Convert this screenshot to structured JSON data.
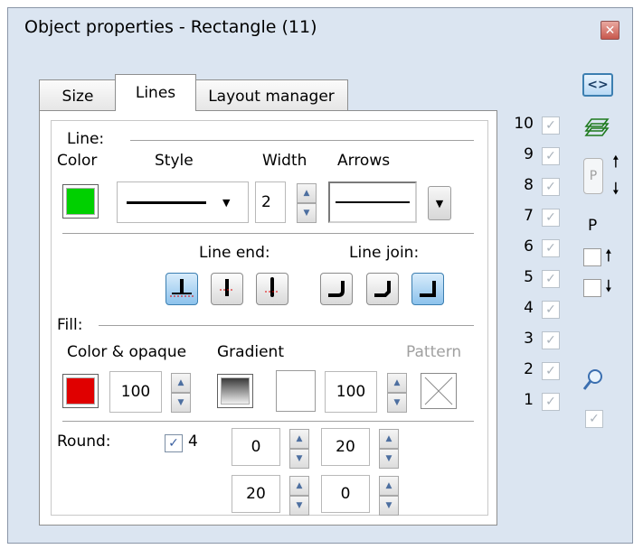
{
  "window": {
    "title": "Object properties - Rectangle (11)"
  },
  "tabs": [
    "Size",
    "Lines",
    "Layout manager"
  ],
  "line": {
    "heading": "Line:",
    "color_label": "Color",
    "style_label": "Style",
    "width_label": "Width",
    "arrows_label": "Arrows",
    "color": "#00d000",
    "width": "2",
    "line_end_label": "Line end:",
    "line_join_label": "Line join:"
  },
  "fill": {
    "heading": "Fill:",
    "color_label": "Color & opaque",
    "gradient_label": "Gradient",
    "pattern_label": "Pattern",
    "color": "#e00000",
    "opaque": "100",
    "gradient_opaque": "100"
  },
  "round": {
    "label": "Round:",
    "check_value": "4",
    "top_left": "0",
    "top_right": "20",
    "bottom_left": "20",
    "bottom_right": "0"
  },
  "side": {
    "expand_label": "<>",
    "layers": [
      "10",
      "9",
      "8",
      "7",
      "6",
      "5",
      "4",
      "3",
      "2",
      "1"
    ],
    "p_label": "P",
    "p_label2": "P"
  },
  "colors": {
    "accent": "#3c7fb1",
    "background": "#dbe5f1"
  }
}
